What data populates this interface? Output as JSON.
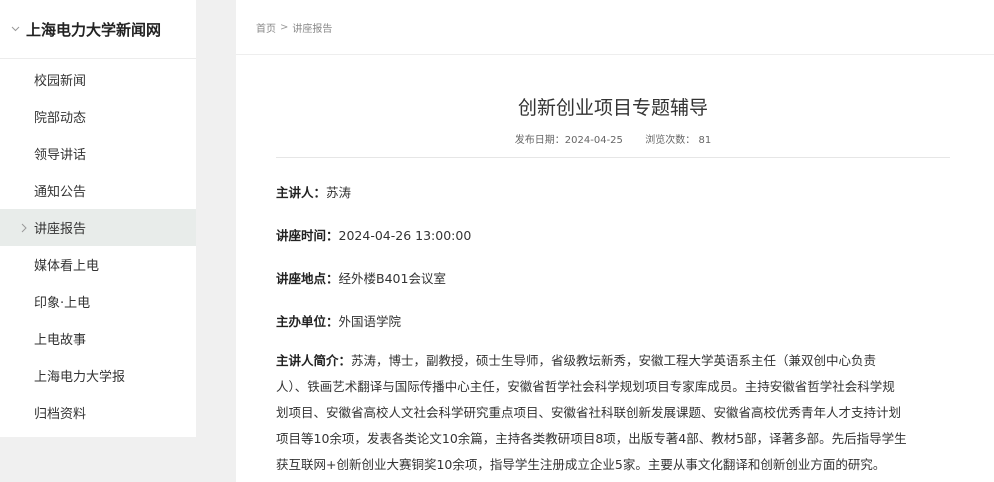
{
  "sidebar": {
    "title": "上海电力大学新闻网",
    "items": [
      {
        "label": "校园新闻"
      },
      {
        "label": "院部动态"
      },
      {
        "label": "领导讲话"
      },
      {
        "label": "通知公告"
      },
      {
        "label": "讲座报告"
      },
      {
        "label": "媒体看上电"
      },
      {
        "label": "印象·上电"
      },
      {
        "label": "上电故事"
      },
      {
        "label": "上海电力大学报"
      },
      {
        "label": "归档资料"
      }
    ],
    "active_index": 4
  },
  "breadcrumb": {
    "home": "首页",
    "separator": ">",
    "current": "讲座报告"
  },
  "article": {
    "title": "创新创业项目专题辅导",
    "publish_label": "发布日期：",
    "publish_date": "2024-04-25",
    "views_label": "浏览次数：",
    "views": "81",
    "fields": [
      {
        "label": "主讲人：",
        "value": "苏涛"
      },
      {
        "label": "讲座时间：",
        "value": "2024-04-26 13:00:00"
      },
      {
        "label": "讲座地点：",
        "value": "经外楼B401会议室"
      },
      {
        "label": "主办单位：",
        "value": "外国语学院"
      }
    ],
    "bio_label": "主讲人简介：",
    "bio_lines": [
      "苏涛，博士，副教授，硕士生导师，省级教坛新秀，安徽工程大学英语系主任（兼双创中心负责",
      "人）、铁画艺术翻译与国际传播中心主任，安徽省哲学社会科学规划项目专家库成员。主持安徽省哲学社会科学规",
      "划项目、安徽省高校人文社会科学研究重点项目、安徽省社科联创新发展课题、安徽省高校优秀青年人才支持计划",
      "项目等10余项，发表各类论文10余篇，主持各类教研项目8项，出版专著4部、教材5部，译著多部。先后指导学生",
      "获互联网+创新创业大赛铜奖10余项，指导学生注册成立企业5家。主要从事文化翻译和创新创业方面的研究。"
    ]
  },
  "colors": {
    "sidebar_active_bg": "#e8ecea",
    "page_bg": "#f0f0f0"
  }
}
